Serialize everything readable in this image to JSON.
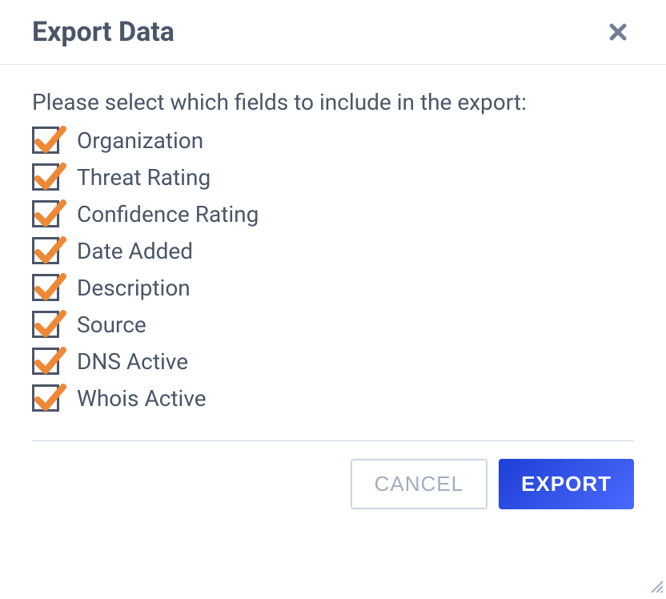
{
  "modal": {
    "title": "Export Data",
    "instruction": "Please select which fields to include in the export:",
    "fields": [
      {
        "label": "Organization",
        "checked": true
      },
      {
        "label": "Threat Rating",
        "checked": true
      },
      {
        "label": "Confidence Rating",
        "checked": true
      },
      {
        "label": "Date Added",
        "checked": true
      },
      {
        "label": "Description",
        "checked": true
      },
      {
        "label": "Source",
        "checked": true
      },
      {
        "label": "DNS Active",
        "checked": true
      },
      {
        "label": "Whois Active",
        "checked": true
      }
    ],
    "buttons": {
      "cancel": "CANCEL",
      "export": "EXPORT"
    }
  }
}
